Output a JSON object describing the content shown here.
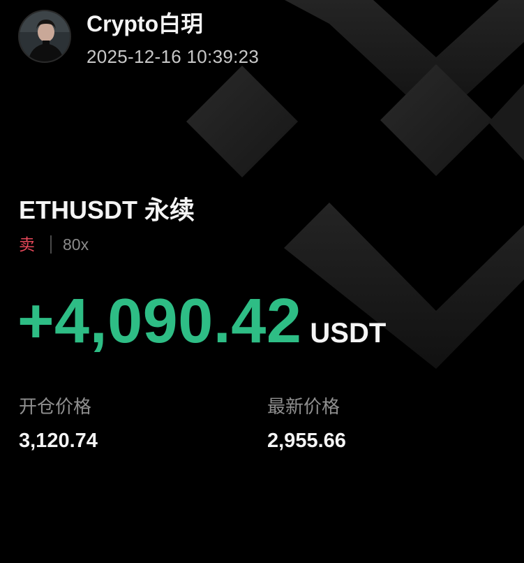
{
  "header": {
    "username": "Crypto白玥",
    "timestamp": "2025-12-16 10:39:23"
  },
  "position": {
    "pair": "ETHUSDT",
    "contract_type": "永续",
    "side": "卖",
    "leverage": "80x"
  },
  "pnl": {
    "value": "+4,090.42",
    "unit": "USDT"
  },
  "fields": {
    "entry_price_label": "开仓价格",
    "entry_price": "3,120.74",
    "last_price_label": "最新价格",
    "last_price": "2,955.66"
  },
  "colors": {
    "background": "#000000",
    "profit_green": "#2ebd85",
    "sell_red": "#e8485a",
    "muted_text": "#8f8f8f",
    "logo_shape": "#1f1f1f"
  },
  "icons": {
    "background_logo": "binance-logo-icon",
    "avatar": "user-avatar"
  }
}
